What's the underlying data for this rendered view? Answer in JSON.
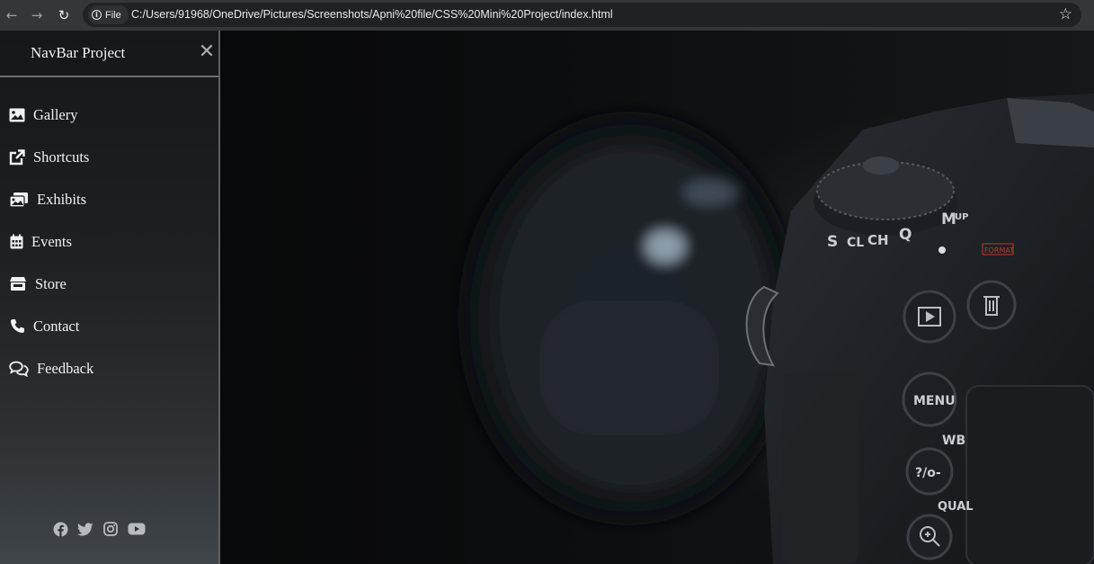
{
  "browser": {
    "back_glyph": "←",
    "forward_glyph": "→",
    "reload_glyph": "↻",
    "site_chip_label": "File",
    "url": "C:/Users/91968/OneDrive/Pictures/Screenshots/Apni%20file/CSS%20Mini%20Project/index.html",
    "star_glyph": "☆"
  },
  "sidebar": {
    "brand": "NavBar Project",
    "close_glyph": "✕",
    "items": [
      {
        "label": "Gallery",
        "icon": "image-icon"
      },
      {
        "label": "Shortcuts",
        "icon": "external-link-icon"
      },
      {
        "label": "Exhibits",
        "icon": "images-icon"
      },
      {
        "label": "Events",
        "icon": "calendar-icon"
      },
      {
        "label": "Store",
        "icon": "store-icon"
      },
      {
        "label": "Contact",
        "icon": "phone-icon"
      },
      {
        "label": "Feedback",
        "icon": "comments-icon"
      }
    ],
    "social": [
      "facebook-icon",
      "twitter-icon",
      "instagram-icon",
      "youtube-icon"
    ]
  },
  "hero": {
    "dial_labels": [
      "S",
      "CL",
      "CH",
      "Q",
      "M",
      "UP"
    ],
    "button_labels": [
      "MENU",
      "WB",
      "?/o-",
      "QUAL",
      "FORMAT"
    ]
  },
  "colors": {
    "chrome_bg": "#35363a",
    "omnibox_bg": "#202124",
    "sidebar_text": "#f1f1f1",
    "sidebar_divider": "#6a6e72",
    "format_red": "#c0392b"
  }
}
